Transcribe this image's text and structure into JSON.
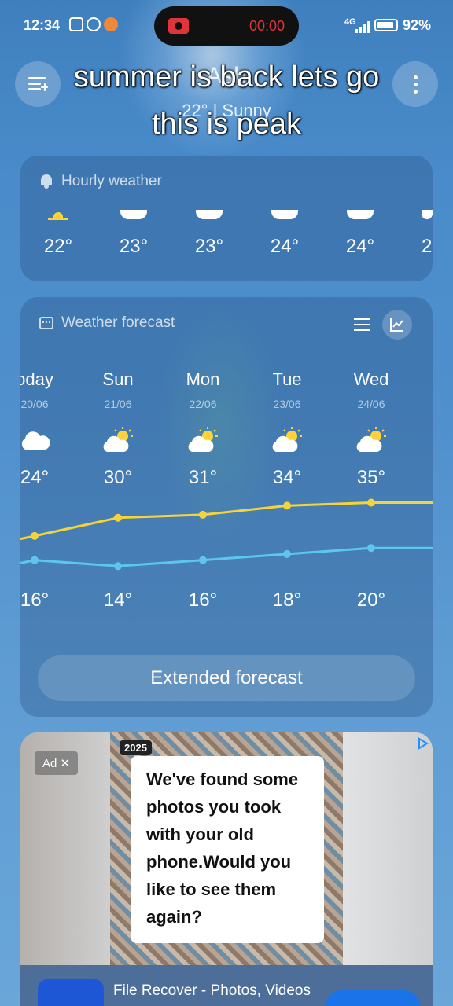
{
  "status_bar": {
    "time": "12:34",
    "record_time": "00:00",
    "network": "4G",
    "battery": "92%",
    "battery_level": 0.92
  },
  "header": {
    "city": "Ash",
    "condition": "22° | Sunny",
    "caption_line1": "summer is back lets go",
    "caption_line2": "this is peak"
  },
  "hourly": {
    "title": "Hourly weather",
    "items": [
      {
        "icon": "sun-icon",
        "temp": "22°"
      },
      {
        "icon": "cloud-icon",
        "temp": "23°"
      },
      {
        "icon": "cloud-icon",
        "temp": "23°"
      },
      {
        "icon": "cloud-icon",
        "temp": "24°"
      },
      {
        "icon": "cloud-icon",
        "temp": "24°"
      },
      {
        "icon": "cloud-icon",
        "temp": "2"
      }
    ]
  },
  "forecast": {
    "title": "Weather forecast",
    "days": [
      {
        "name": "oday",
        "date": "20/06",
        "icon": "cloud-icon",
        "high": "24°",
        "low": "16°"
      },
      {
        "name": "Sun",
        "date": "21/06",
        "icon": "partly-sunny-icon",
        "high": "30°",
        "low": "14°"
      },
      {
        "name": "Mon",
        "date": "22/06",
        "icon": "partly-sunny-icon",
        "high": "31°",
        "low": "16°"
      },
      {
        "name": "Tue",
        "date": "23/06",
        "icon": "partly-sunny-icon",
        "high": "34°",
        "low": "18°"
      },
      {
        "name": "Wed",
        "date": "24/06",
        "icon": "partly-sunny-icon",
        "high": "35°",
        "low": "20°"
      }
    ],
    "highs": [
      24,
      30,
      31,
      34,
      35
    ],
    "lows": [
      16,
      14,
      16,
      18,
      20
    ],
    "high_color": "#f5d33a",
    "low_color": "#5cc6f0",
    "extended_label": "Extended forecast"
  },
  "ad": {
    "tag": "Ad ✕",
    "year": "2025",
    "headline": "We've found some photos you took with your old phone.Would you like to see them again?",
    "app_name": "File Recover - Photos, Videos"
  }
}
